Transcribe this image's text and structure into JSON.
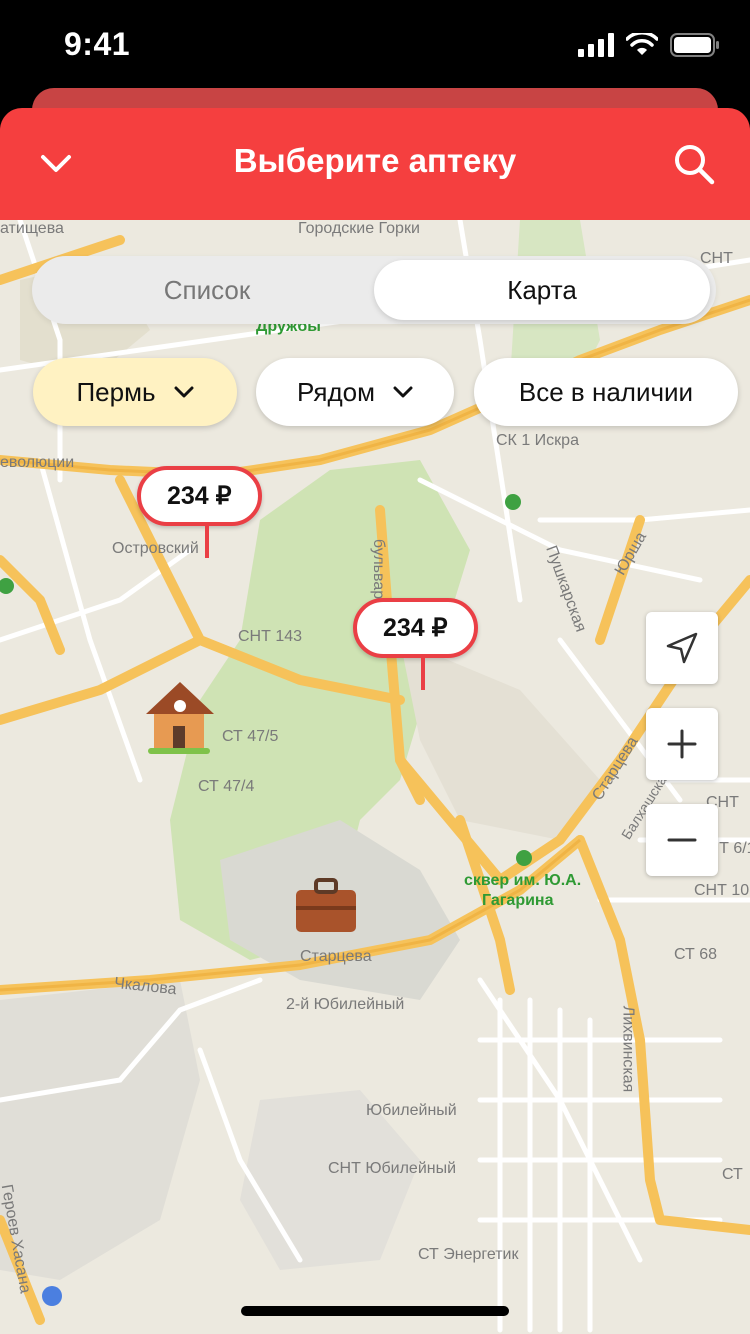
{
  "status_bar": {
    "time": "9:41"
  },
  "header": {
    "title": "Выберите аптеку",
    "back_icon": "chevron-down-icon",
    "search_icon": "search-icon"
  },
  "segmented": {
    "options": [
      "Список",
      "Карта"
    ],
    "selected": "Карта"
  },
  "filters": {
    "city": "Пермь",
    "distance": "Рядом",
    "availability": "Все в наличии"
  },
  "pins": [
    {
      "price": "234 ₽"
    },
    {
      "price": "234 ₽"
    }
  ],
  "map_controls": {
    "locate": "navigation-arrow-icon",
    "zoom_in": "+",
    "zoom_out": "−"
  },
  "map_labels": {
    "tatishcheva": "атищева",
    "gorodskie_gorki": "Городские Горки",
    "druzhby": "Дружбы",
    "snt": "СНТ",
    "revolyutsii": "еволюции",
    "sk_iskra": "СК 1 Искра",
    "ostrovskogo": "Островский",
    "snt143": "СНТ 143",
    "bulvar": "бульвар",
    "pushkarskaya": "Пушкарская",
    "yursha": "Юрша",
    "st47_5": "СТ 47/5",
    "st47_4": "СТ 47/4",
    "startseva1": "Старцева",
    "balhashskaya": "Балхашская",
    "skver": "сквер им. Ю.А.",
    "gagarina": "Гагарина",
    "startseva2": "Старцева",
    "chkalova": "Чкалова",
    "yubileyny2": "2-й Юбилейный",
    "st68": "СТ 68",
    "likhvinskaya": "Лихвинская",
    "yubileyny": "Юбилейный",
    "snt_yubileyny": "СНТ Юбилейный",
    "st_energetik": "СТ Энергетик",
    "geroev_hasana": "Героев Хасана",
    "snt_edge1": "СНТ",
    "snt_edge2": "СНТ 6/1",
    "snt_edge3": "СНТ 10",
    "st_edge": "СТ"
  },
  "colors": {
    "header_red": "#f53f3f",
    "pin_red": "#ea3f45",
    "chip_yellow": "#fff2c2",
    "road_yellow": "#f6c25a"
  }
}
